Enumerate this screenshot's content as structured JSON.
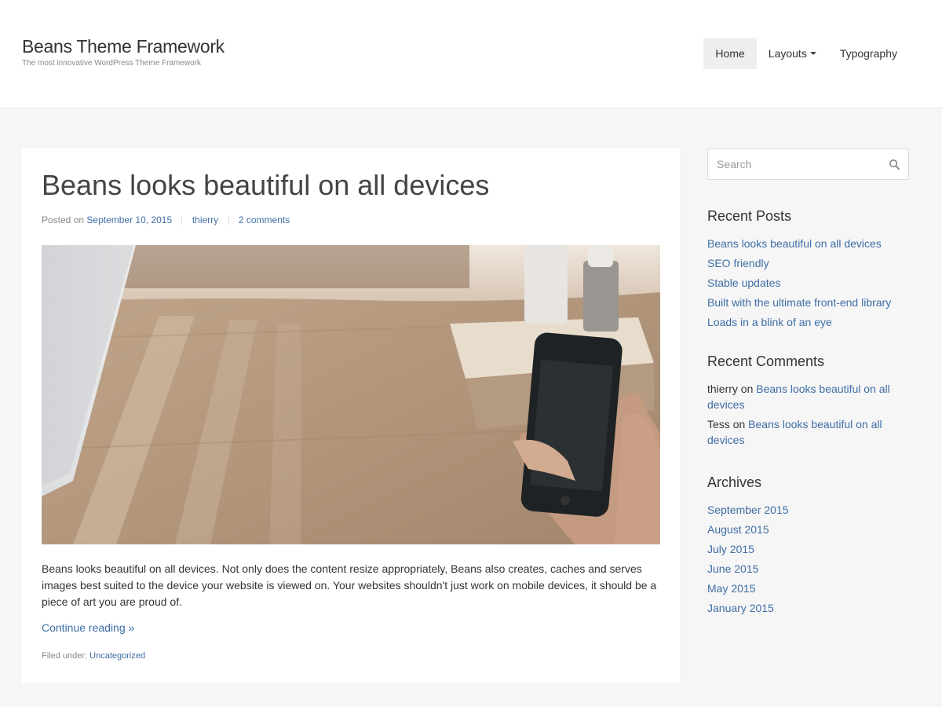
{
  "header": {
    "site_title": "Beans Theme Framework",
    "site_tagline": "The most innovative WordPress Theme Framework",
    "nav": [
      {
        "label": "Home",
        "active": true
      },
      {
        "label": "Layouts",
        "has_dropdown": true
      },
      {
        "label": "Typography"
      }
    ]
  },
  "post": {
    "title": "Beans looks beautiful on all devices",
    "meta": {
      "posted_on_label": "Posted on",
      "date": "September 10, 2015",
      "author": "thierry",
      "comments": "2 comments"
    },
    "image_icon": "phone-on-wooden-table-photo",
    "excerpt": "Beans looks beautiful on all devices. Not only does the content resize appropriately, Beans also creates, caches and serves images best suited to the device your website is viewed on. Your websites shouldn't just work on mobile devices, it should be a piece of art you are proud of.",
    "read_more": "Continue reading »",
    "filed_under_label": "Filed under:",
    "category": "Uncategorized"
  },
  "sidebar": {
    "search": {
      "placeholder": "Search",
      "value": ""
    },
    "recent_posts": {
      "title": "Recent Posts",
      "items": [
        "Beans looks beautiful on all devices",
        "SEO friendly",
        "Stable updates",
        "Built with the ultimate front-end library",
        "Loads in a blink of an eye"
      ]
    },
    "recent_comments": {
      "title": "Recent Comments",
      "items": [
        {
          "author": "thierry",
          "on": "on",
          "post": "Beans looks beautiful on all devices"
        },
        {
          "author": "Tess",
          "on": "on",
          "post": "Beans looks beautiful on all devices"
        }
      ]
    },
    "archives": {
      "title": "Archives",
      "items": [
        "September 2015",
        "August 2015",
        "July 2015",
        "June 2015",
        "May 2015",
        "January 2015"
      ]
    }
  },
  "colors": {
    "link": "#3e6da5",
    "page_background": "#f6f6f6",
    "active_nav_background": "#efefef"
  }
}
